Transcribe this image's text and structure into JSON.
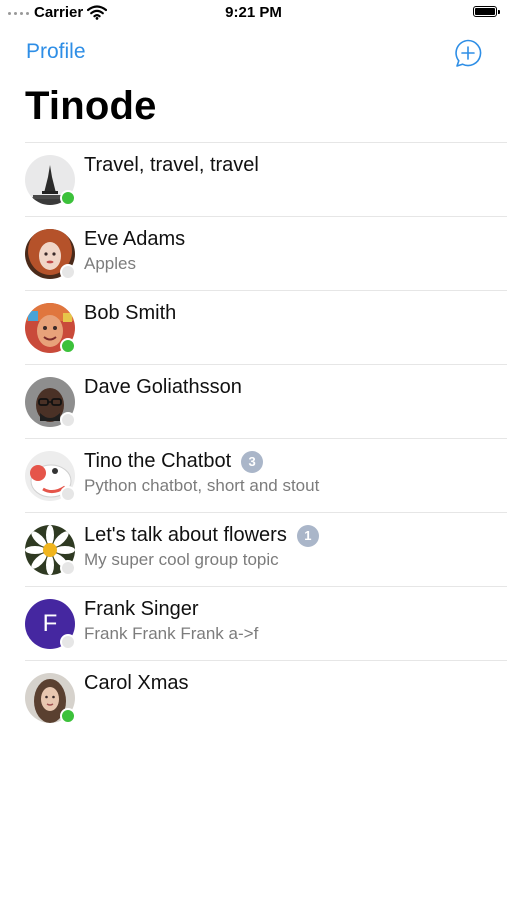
{
  "status_bar": {
    "carrier": "Carrier",
    "time": "9:21 PM"
  },
  "nav": {
    "left_button": "Profile",
    "right_icon": "new-chat-icon"
  },
  "title": "Tinode",
  "colors": {
    "accent": "#2e8ee6",
    "online": "#3cc13b",
    "offline": "#e6e6e6",
    "badge": "#aab6c9"
  },
  "chats": [
    {
      "title": "Travel, travel, travel",
      "subtitle": "",
      "badge": "",
      "online": true,
      "avatar": "eiffel-tower"
    },
    {
      "title": "Eve Adams",
      "subtitle": "Apples",
      "badge": "",
      "online": false,
      "avatar": "woman-red-hair"
    },
    {
      "title": "Bob Smith",
      "subtitle": "",
      "badge": "",
      "online": true,
      "avatar": "man-colorful"
    },
    {
      "title": "Dave Goliathsson",
      "subtitle": "",
      "badge": "",
      "online": false,
      "avatar": "man-glasses"
    },
    {
      "title": "Tino the Chatbot",
      "subtitle": "Python chatbot, short and stout",
      "badge": "3",
      "online": false,
      "avatar": "robot"
    },
    {
      "title": "Let's talk about flowers",
      "subtitle": "My super cool group topic",
      "badge": "1",
      "online": false,
      "avatar": "daisy"
    },
    {
      "title": "Frank Singer",
      "subtitle": "Frank Frank Frank a->f",
      "badge": "",
      "online": false,
      "avatar": "letter",
      "avatar_letter": "F"
    },
    {
      "title": "Carol Xmas",
      "subtitle": "",
      "badge": "",
      "online": true,
      "avatar": "woman-portrait"
    }
  ]
}
